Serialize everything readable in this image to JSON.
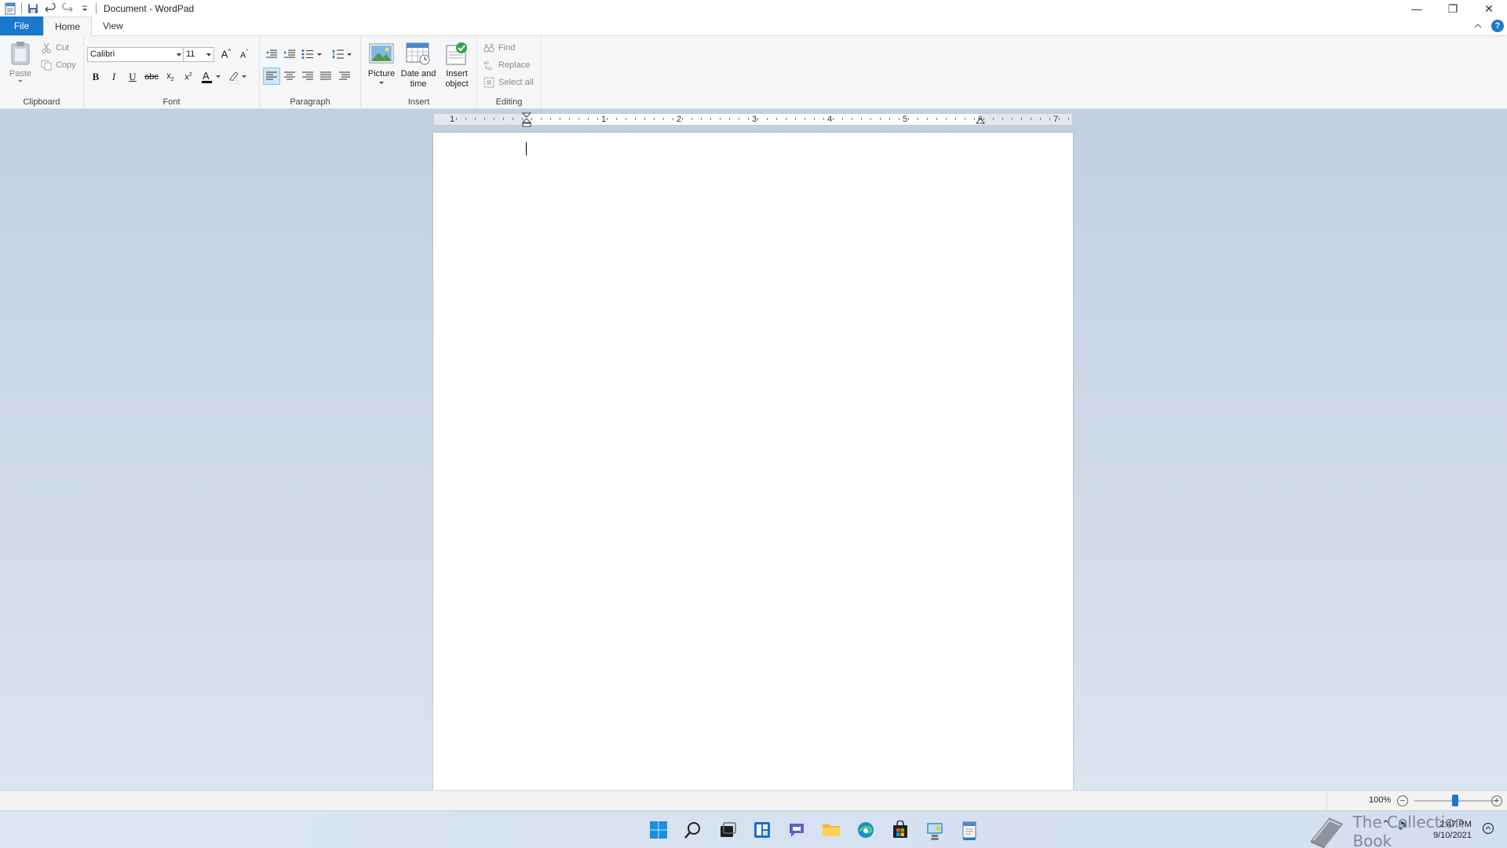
{
  "window": {
    "title": "Document - WordPad",
    "minimize_label": "—",
    "maximize_label": "❐",
    "close_label": "✕"
  },
  "tabs": [
    {
      "label": "File"
    },
    {
      "label": "Home"
    },
    {
      "label": "View"
    }
  ],
  "ribbon": {
    "clipboard": {
      "group_label": "Clipboard",
      "paste": "Paste",
      "cut": "Cut",
      "copy": "Copy"
    },
    "font": {
      "group_label": "Font",
      "font_name": "Calibri",
      "font_size": "11"
    },
    "paragraph": {
      "group_label": "Paragraph"
    },
    "insert": {
      "group_label": "Insert",
      "picture": "Picture",
      "date_time_1": "Date and",
      "date_time_2": "time",
      "insert_object_1": "Insert",
      "insert_object_2": "object"
    },
    "editing": {
      "group_label": "Editing",
      "find": "Find",
      "replace": "Replace",
      "select_all": "Select all"
    }
  },
  "ruler": {
    "numbers": [
      "1",
      "1",
      "2",
      "3",
      "4",
      "5",
      "6",
      "7"
    ]
  },
  "status": {
    "zoom": "100%",
    "zoom_fraction": 0.5
  },
  "taskbar": {
    "time": "2:47 PM",
    "date": "9/10/2021"
  },
  "watermark": {
    "text": "The Collection Book"
  },
  "colors": {
    "accent": "#1979ca",
    "ribbon_bg": "#f5f6f7",
    "workspace_top": "#c3cfe2"
  }
}
